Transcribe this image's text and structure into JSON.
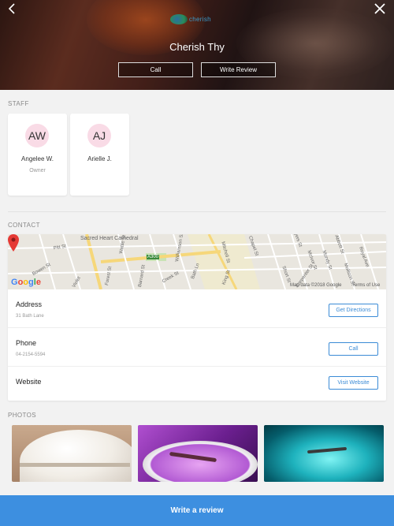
{
  "header": {
    "business_name": "Cherish Thy",
    "logo_text": "cherish",
    "call_label": "Call",
    "review_label": "Write Review"
  },
  "staff": {
    "section_label": "STAFF",
    "members": [
      {
        "initials": "AW",
        "name": "Angelee W.",
        "role": "Owner"
      },
      {
        "initials": "AJ",
        "name": "Arielle J.",
        "role": ""
      }
    ]
  },
  "contact": {
    "section_label": "CONTACT",
    "map": {
      "labels": [
        "Sacred Heart Cathedral",
        "Mitchell St",
        "Pitt St",
        "Bowen St",
        "Violet",
        "A300",
        "Creek St",
        "Bath Ln",
        "King St",
        "Myers St",
        "McIvor St",
        "Mundy St",
        "Abbott St",
        "Royal Ave",
        "Carpenter St",
        "Barnard St",
        "Williamson St",
        "Forest St",
        "Wattle St",
        "Chapel St",
        "Short St",
        "Mollison St"
      ],
      "google_letters": [
        "G",
        "o",
        "o",
        "g",
        "l",
        "e"
      ],
      "attribution": "Map data ©2018 Google",
      "terms": "Terms of Use"
    },
    "rows": [
      {
        "title": "Address",
        "value": "31 Bath Lane",
        "button": "Get Directions"
      },
      {
        "title": "Phone",
        "value": "04-2154-5594",
        "button": "Call"
      },
      {
        "title": "Website",
        "value": "",
        "button": "Visit Website"
      }
    ]
  },
  "photos": {
    "section_label": "PHOTOS"
  },
  "footer": {
    "cta_label": "Write a review"
  },
  "colors": {
    "accent": "#3d8fe0",
    "avatar_bg": "#f9dbe6",
    "map_pin": "#e53935"
  }
}
